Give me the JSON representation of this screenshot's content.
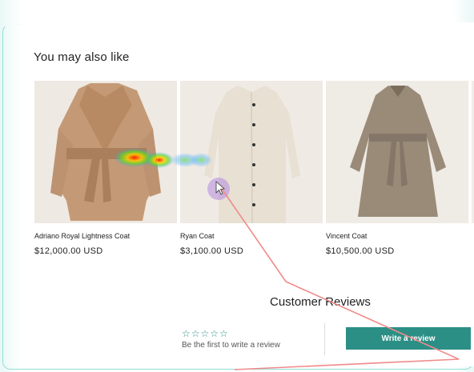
{
  "section": {
    "title": "You may also like"
  },
  "products": [
    {
      "name": "Adriano Royal Lightness Coat",
      "price": "$12,000.00 USD"
    },
    {
      "name": "Ryan Coat",
      "price": "$3,100.00 USD"
    },
    {
      "name": "Vincent Coat",
      "price": "$10,500.00 USD"
    }
  ],
  "reviews": {
    "title": "Customer Reviews",
    "stars": "☆☆☆☆☆",
    "empty_text": "Be the first to write a review",
    "write_button": "Write a review"
  },
  "colors": {
    "accent": "#2c8f86",
    "frame": "#8fded3",
    "trail": "#f08a8a"
  },
  "icons": [
    "cursor-icon",
    "star-icon"
  ]
}
